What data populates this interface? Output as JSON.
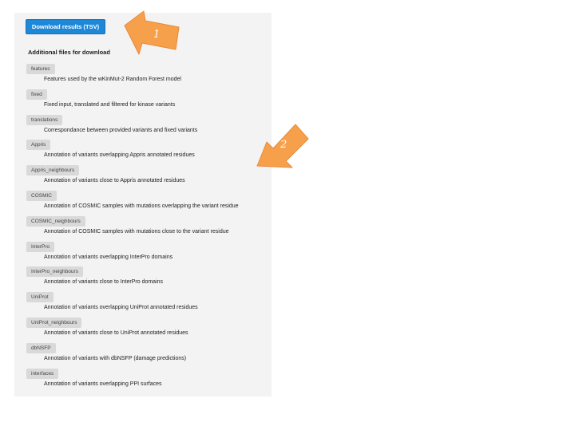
{
  "download_button": {
    "label": "Download results (TSV)"
  },
  "section_title": "Additional files for download",
  "files": [
    {
      "tag": "features",
      "description": "Features used by the wKinMut-2 Random Forest model"
    },
    {
      "tag": "fixed",
      "description": "Fixed input, translated and filtered for kinase variants"
    },
    {
      "tag": "translations",
      "description": "Correspondance between provided variants and fixed variants"
    },
    {
      "tag": "Appris",
      "description": "Annotation of variants overlapping Appris annotated residues"
    },
    {
      "tag": "Appris_neighbours",
      "description": "Annotation of variants close to Appris annotated residues"
    },
    {
      "tag": "COSMIC",
      "description": "Annotation of COSMIC samples with mutations overlapping the variant residue"
    },
    {
      "tag": "COSMIC_neighbours",
      "description": "Annotation of COSMIC samples with mutations close to the variant residue"
    },
    {
      "tag": "InterPro",
      "description": "Annotation of variants overlapping InterPro domains"
    },
    {
      "tag": "InterPro_neighbours",
      "description": "Annotation of variants close to InterPro domains"
    },
    {
      "tag": "UniProt",
      "description": "Annotation of variants overlapping UniProt annotated residues"
    },
    {
      "tag": "UniProt_neighbours",
      "description": "Annotation of variants close to UniProt annotated residues"
    },
    {
      "tag": "dbNSFP",
      "description": "Annotation of variants with dbNSFP (damage predictions)"
    },
    {
      "tag": "interfaces",
      "description": "Annotation of variants overlapping PPI surfaces"
    }
  ],
  "annotations": [
    {
      "label": "1",
      "icon": "arrow-left-icon",
      "color": "#f7a04b"
    },
    {
      "label": "2",
      "icon": "arrow-down-left-icon",
      "color": "#f7a04b"
    }
  ]
}
